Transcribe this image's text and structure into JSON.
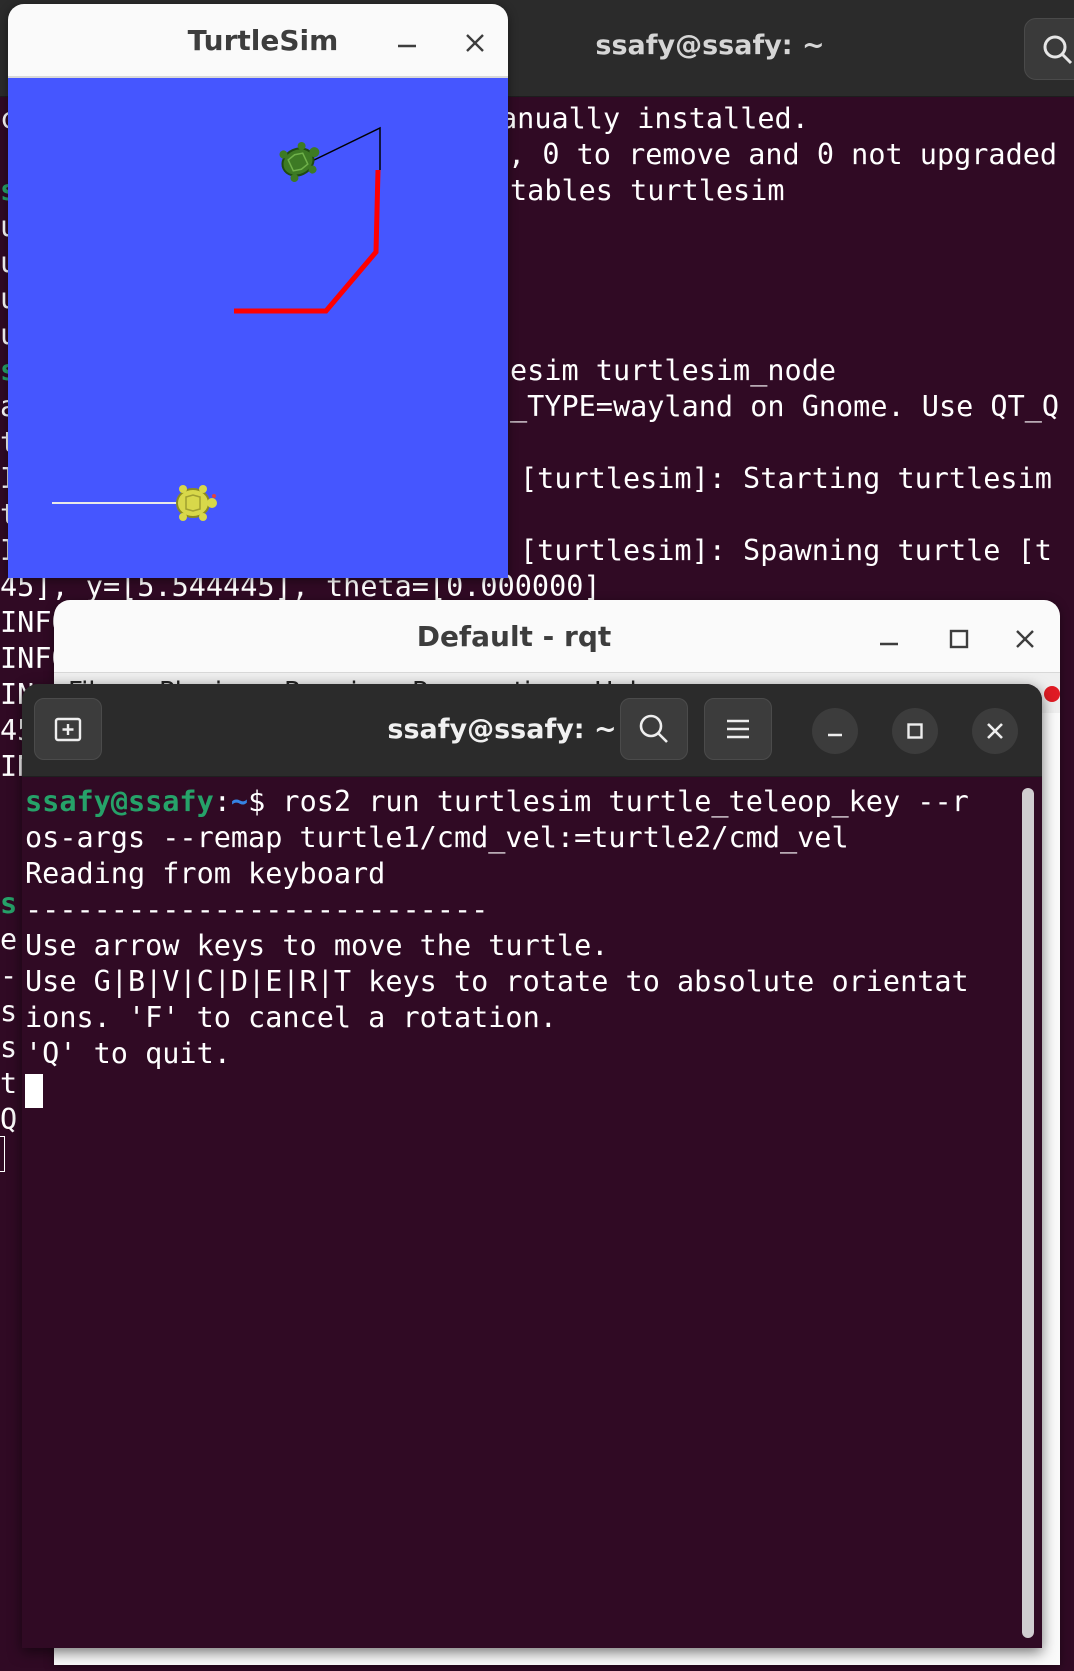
{
  "background_terminal": {
    "title": "ssafy@ssafy: ~",
    "visible_lines": [
      "anually installed.",
      ", 0 to remove and 0 not upgraded",
      "tables turtlesim",
      "esim turtlesim_node",
      "_TYPE=wayland on Gnome. Use QT_Q",
      "[turtlesim]: Starting turtlesim",
      "[turtlesim]: Spawning turtle [t",
      "45], y=[5.544445], theta=[0.000000]"
    ],
    "left_edge_chars": [
      "c",
      "s",
      "u",
      "u",
      "u",
      "u",
      "s",
      "a",
      "t",
      "I",
      "t",
      "I",
      "INFO",
      "INFO",
      "IN",
      "45",
      "IN",
      "s",
      "e",
      "-",
      "s",
      "s",
      "t",
      "Q"
    ],
    "right_edge_chars": [
      "m",
      "i",
      "i"
    ]
  },
  "turtlesim": {
    "title": "TurtleSim",
    "background_color": "#4556ff",
    "pen_colors": {
      "turtle1": "#ffffff",
      "turtle2_trail": "#ff0000",
      "thin_trail": "#000000"
    }
  },
  "rqt": {
    "title": "Default - rqt",
    "menu_items": [
      "File",
      "Plugins",
      "Running",
      "Perspectives",
      "Help"
    ]
  },
  "terminal": {
    "title": "ssafy@ssafy: ~",
    "prompt_user": "ssafy@ssafy",
    "prompt_sep": ":",
    "prompt_path": "~",
    "prompt_dollar": "$ ",
    "command_line1": "ros2 run turtlesim turtle_teleop_key --r",
    "command_line2": "os-args --remap turtle1/cmd_vel:=turtle2/cmd_vel",
    "output": [
      "Reading from keyboard",
      "---------------------------",
      "Use arrow keys to move the turtle.",
      "Use G|B|V|C|D|E|R|T keys to rotate to absolute orientat",
      "ions. 'F' to cancel a rotation.",
      "'Q' to quit."
    ]
  },
  "icons": {
    "new_tab": "new-tab-icon",
    "search": "search-icon",
    "menu": "hamburger-menu-icon",
    "minimize": "minimize-icon",
    "maximize": "maximize-icon",
    "close": "close-icon"
  }
}
